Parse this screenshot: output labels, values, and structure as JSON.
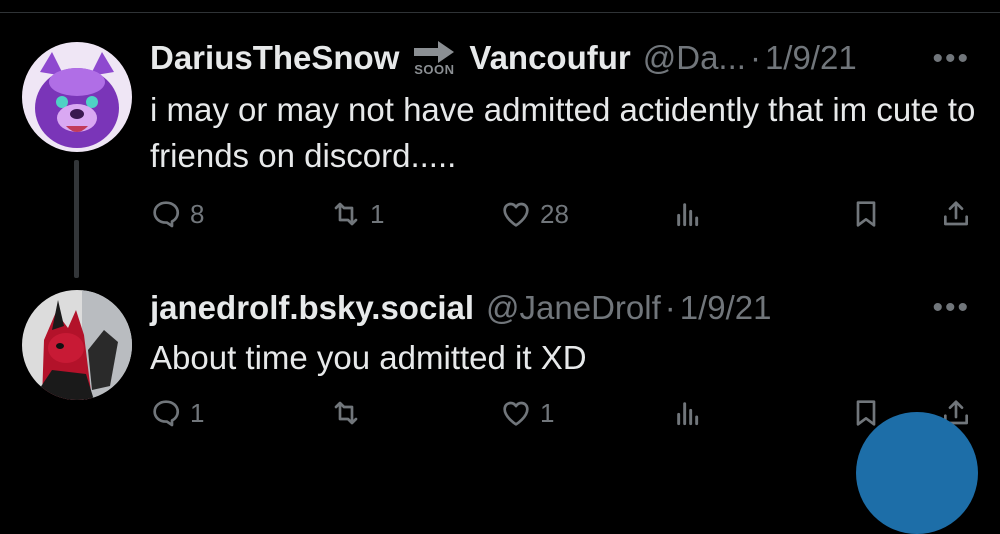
{
  "tweets": [
    {
      "name": "DariusTheSnow",
      "badge": "SOON",
      "name2": "Vancoufur",
      "handle": "@Da...",
      "dot": "·",
      "date": "1/9/21",
      "text": "i may or may not have admitted actidently that im cute to friends on discord.....",
      "replies": "8",
      "retweets": "1",
      "likes": "28"
    },
    {
      "name": "janedrolf.bsky.social",
      "handle": "@JaneDrolf",
      "dot": "·",
      "date": "1/9/21",
      "text": "About time you admitted it XD",
      "replies": "1",
      "retweets": "",
      "likes": "1"
    }
  ],
  "more_label": "•••",
  "colors": {
    "background": "#000000",
    "text": "#e7e9ea",
    "secondary": "#71767b",
    "fab": "#1d6ea8"
  },
  "icons": [
    "reply-icon",
    "retweet-icon",
    "like-icon",
    "views-icon",
    "bookmark-icon",
    "share-icon",
    "arrow-right-icon"
  ]
}
